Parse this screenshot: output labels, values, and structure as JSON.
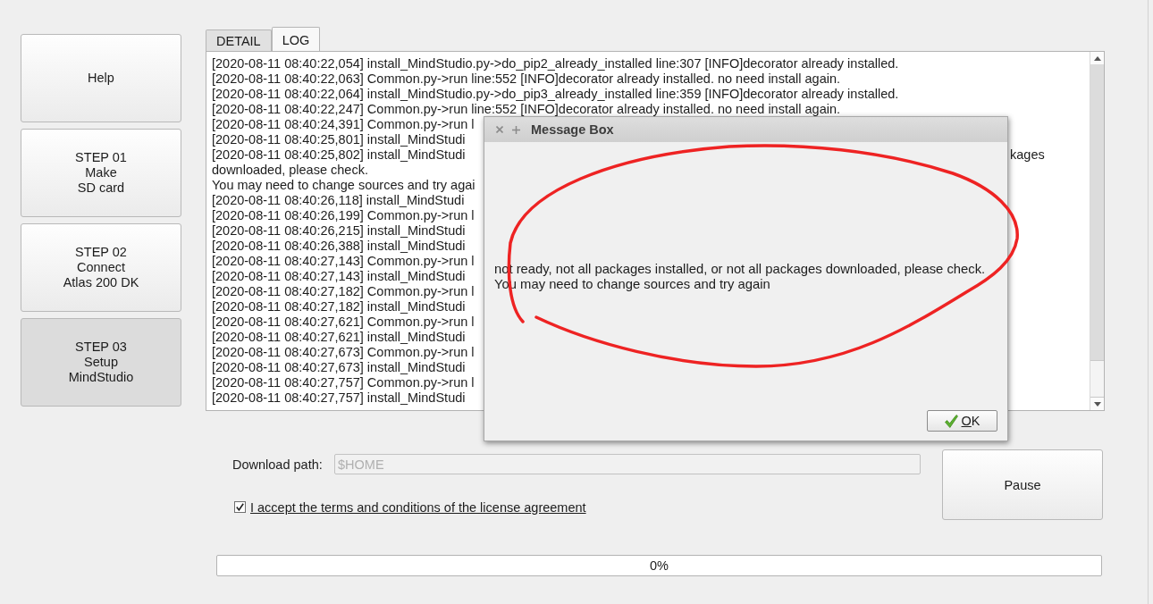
{
  "sidebar": {
    "buttons": [
      {
        "label": "Help",
        "selected": false
      },
      {
        "label": "STEP 01\nMake\nSD card",
        "selected": false
      },
      {
        "label": "STEP 02\nConnect\nAtlas 200 DK",
        "selected": false
      },
      {
        "label": "STEP 03\nSetup\nMindStudio",
        "selected": true
      }
    ]
  },
  "tabs": [
    {
      "label": "DETAIL",
      "selected": false
    },
    {
      "label": "LOG",
      "selected": true
    }
  ],
  "log": {
    "lines": [
      {
        "text": "[2020-08-11 08:40:22,054] install_MindStudio.py->do_pip2_already_installed line:307 [INFO]decorator already installed."
      },
      {
        "text": "[2020-08-11 08:40:22,063] Common.py->run line:552 [INFO]decorator already installed. no need install again."
      },
      {
        "text": "[2020-08-11 08:40:22,064] install_MindStudio.py->do_pip3_already_installed line:359 [INFO]decorator already installed."
      },
      {
        "text": "[2020-08-11 08:40:22,247] Common.py->run line:552 [INFO]decorator already installed. no need install again."
      },
      {
        "text": "[2020-08-11 08:40:24,391] Common.py->run l"
      },
      {
        "text": "[2020-08-11 08:40:25,801] install_MindStudi"
      },
      {
        "text": "[2020-08-11 08:40:25,802] install_MindStudi",
        "tail": "kages"
      },
      {
        "text": "downloaded, please check."
      },
      {
        "text": "You may need to change sources and try agai"
      },
      {
        "text": "[2020-08-11 08:40:26,118] install_MindStudi"
      },
      {
        "text": "[2020-08-11 08:40:26,199] Common.py->run l"
      },
      {
        "text": "[2020-08-11 08:40:26,215] install_MindStudi"
      },
      {
        "text": "[2020-08-11 08:40:26,388] install_MindStudi"
      },
      {
        "text": "[2020-08-11 08:40:27,143] Common.py->run l"
      },
      {
        "text": "[2020-08-11 08:40:27,143] install_MindStudi"
      },
      {
        "text": "[2020-08-11 08:40:27,182] Common.py->run l"
      },
      {
        "text": "[2020-08-11 08:40:27,182] install_MindStudi"
      },
      {
        "text": "[2020-08-11 08:40:27,621] Common.py->run l"
      },
      {
        "text": "[2020-08-11 08:40:27,621] install_MindStudi"
      },
      {
        "text": "[2020-08-11 08:40:27,673] Common.py->run l"
      },
      {
        "text": "[2020-08-11 08:40:27,673] install_MindStudi"
      },
      {
        "text": "[2020-08-11 08:40:27,757] Common.py->run l"
      },
      {
        "text": "[2020-08-11 08:40:27,757] install_MindStudi"
      }
    ]
  },
  "message_box": {
    "title": "Message Box",
    "message": "not ready, not all packages installed, or not all packages downloaded, please check.\nYou may need to change sources and try again",
    "button": "OK"
  },
  "download_path": {
    "label": "Download path:",
    "placeholder": "$HOME"
  },
  "license": {
    "label": "I accept the terms and conditions of the license agreement",
    "checked": true
  },
  "pause_button": {
    "label": "Pause"
  },
  "progress": {
    "level": 0,
    "reading": "0%"
  }
}
